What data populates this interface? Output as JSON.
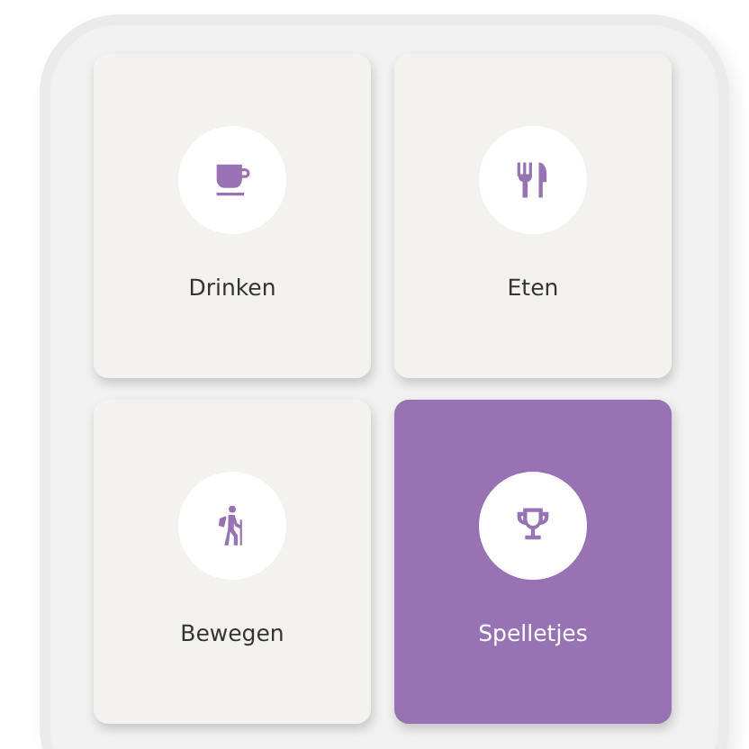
{
  "tiles": [
    {
      "label": "Drinken",
      "kind": "cup",
      "selected": false
    },
    {
      "label": "Eten",
      "kind": "cutlery",
      "selected": false
    },
    {
      "label": "Bewegen",
      "kind": "hiker",
      "selected": false
    },
    {
      "label": "Spelletjes",
      "kind": "trophy",
      "selected": true
    }
  ]
}
